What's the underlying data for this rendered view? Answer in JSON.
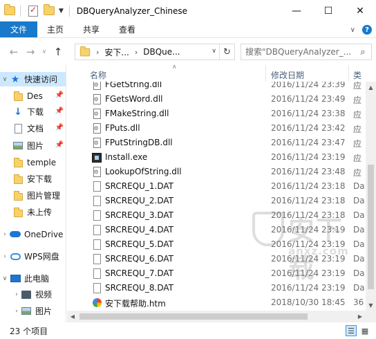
{
  "window": {
    "title": "DBQueryAnalyzer_Chinese",
    "minimize": "—",
    "maximize": "☐",
    "close": "✕"
  },
  "ribbon": {
    "tabs": [
      {
        "label": "文件"
      },
      {
        "label": "主页"
      },
      {
        "label": "共享"
      },
      {
        "label": "查看"
      }
    ]
  },
  "address": {
    "crumbs": [
      "安下...",
      "DBQue..."
    ]
  },
  "search": {
    "placeholder": "搜索\"DBQueryAnalyzer_..."
  },
  "sidebar": {
    "items": [
      {
        "label": "快速访问",
        "icon": "star-icon",
        "selected": true
      },
      {
        "label": "Des",
        "icon": "folder-icon",
        "pinned": true
      },
      {
        "label": "下载",
        "icon": "download-icon",
        "pinned": true
      },
      {
        "label": "文档",
        "icon": "document-icon",
        "pinned": true
      },
      {
        "label": "图片",
        "icon": "picture-icon",
        "pinned": true
      },
      {
        "label": "temple",
        "icon": "folder-icon"
      },
      {
        "label": "安下载",
        "icon": "folder-icon"
      },
      {
        "label": "图片管理",
        "icon": "folder-icon"
      },
      {
        "label": "未上传",
        "icon": "folder-icon"
      },
      {
        "label": "OneDrive",
        "icon": "cloud-icon"
      },
      {
        "label": "WPS网盘",
        "icon": "wps-cloud-icon"
      },
      {
        "label": "此电脑",
        "icon": "computer-icon"
      },
      {
        "label": "视频",
        "icon": "video-icon"
      },
      {
        "label": "图片",
        "icon": "picture-icon"
      }
    ]
  },
  "columns": {
    "name": "名称",
    "date": "修改日期",
    "type": "类"
  },
  "files": [
    {
      "name": "FGetString.dll",
      "date": "2016/11/24 23:39",
      "type": "应",
      "icon": "dll"
    },
    {
      "name": "FGetsWord.dll",
      "date": "2016/11/24 23:49",
      "type": "应",
      "icon": "dll"
    },
    {
      "name": "FMakeString.dll",
      "date": "2016/11/24 23:38",
      "type": "应",
      "icon": "dll"
    },
    {
      "name": "FPuts.dll",
      "date": "2016/11/24 23:42",
      "type": "应",
      "icon": "dll"
    },
    {
      "name": "FPutStringDB.dll",
      "date": "2016/11/24 23:47",
      "type": "应",
      "icon": "dll"
    },
    {
      "name": "Install.exe",
      "date": "2016/11/24 23:19",
      "type": "应",
      "icon": "exe"
    },
    {
      "name": "LookupOfString.dll",
      "date": "2016/11/24 23:48",
      "type": "应",
      "icon": "dll"
    },
    {
      "name": "SRCREQU_1.DAT",
      "date": "2016/11/24 23:18",
      "type": "Da",
      "icon": "dat"
    },
    {
      "name": "SRCREQU_2.DAT",
      "date": "2016/11/24 23:18",
      "type": "Da",
      "icon": "dat"
    },
    {
      "name": "SRCREQU_3.DAT",
      "date": "2016/11/24 23:18",
      "type": "Da",
      "icon": "dat"
    },
    {
      "name": "SRCREQU_4.DAT",
      "date": "2016/11/24 23:19",
      "type": "Da",
      "icon": "dat"
    },
    {
      "name": "SRCREQU_5.DAT",
      "date": "2016/11/24 23:19",
      "type": "Da",
      "icon": "dat"
    },
    {
      "name": "SRCREQU_6.DAT",
      "date": "2016/11/24 23:19",
      "type": "Da",
      "icon": "dat"
    },
    {
      "name": "SRCREQU_7.DAT",
      "date": "2016/11/24 23:19",
      "type": "Da",
      "icon": "dat"
    },
    {
      "name": "SRCREQU_8.DAT",
      "date": "2016/11/24 23:19",
      "type": "Da",
      "icon": "dat"
    },
    {
      "name": "安下载帮助.htm",
      "date": "2018/10/30 18:45",
      "type": "36",
      "icon": "htm"
    }
  ],
  "watermark": {
    "main": "安下载",
    "sub": "anxz.com"
  },
  "status": {
    "count": "23 个项目"
  },
  "colors": {
    "accent": "#1979ca",
    "selection": "#cce8ff"
  }
}
